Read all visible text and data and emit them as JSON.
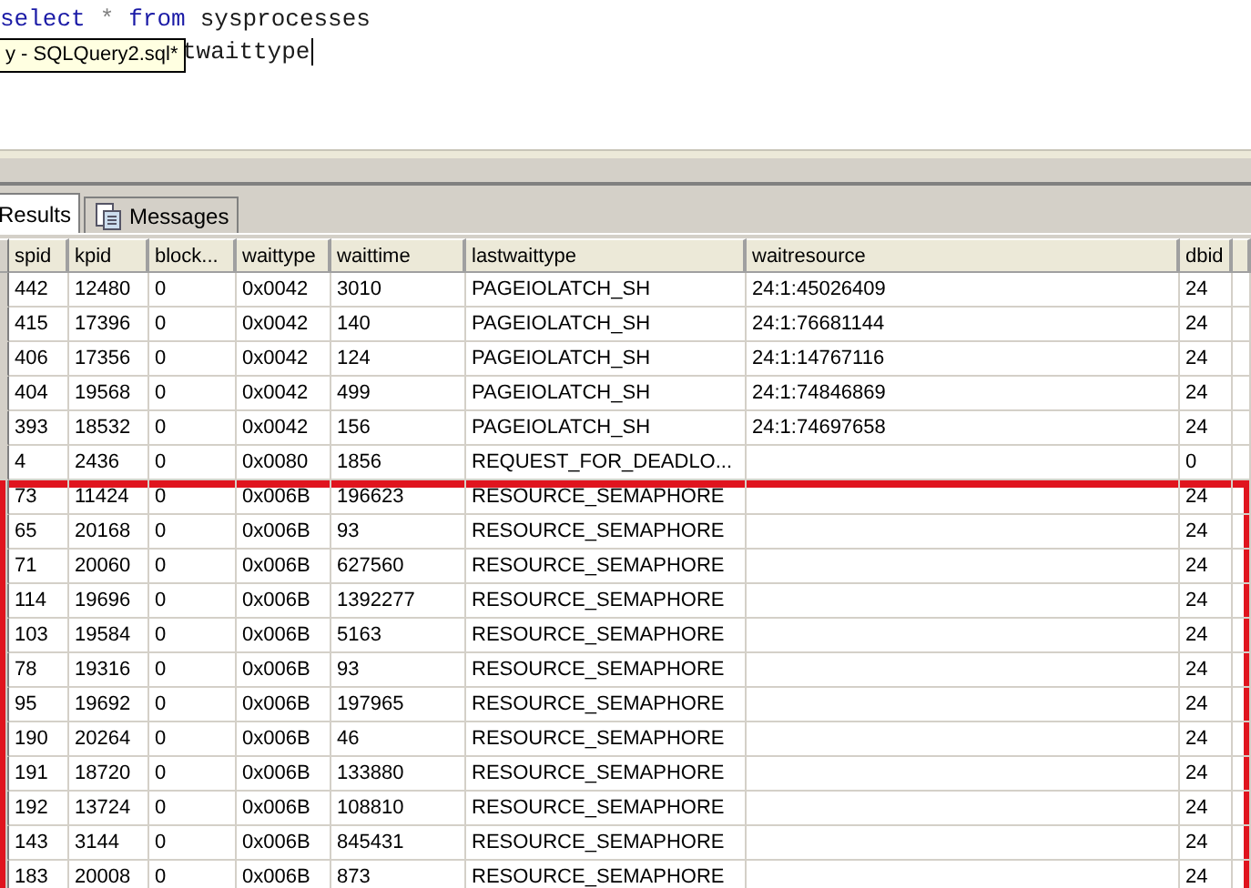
{
  "editor": {
    "lines": [
      {
        "tokens": [
          {
            "text": "select",
            "kind": "keyword"
          },
          {
            "text": "*",
            "kind": "operator"
          },
          {
            "text": "from",
            "kind": "keyword"
          },
          {
            "text": "sysprocesses",
            "kind": "identifier"
          }
        ]
      },
      {
        "tokens": [
          {
            "text": "twaittype",
            "kind": "identifier"
          }
        ],
        "caret": true
      }
    ],
    "tooltip": "y - SQLQuery2.sql*"
  },
  "tabs": [
    {
      "label": "Results",
      "selected": true
    },
    {
      "label": "Messages",
      "selected": false
    }
  ],
  "table": {
    "columns": [
      "spid",
      "kpid",
      "block...",
      "waittype",
      "waittime",
      "lastwaittype",
      "waitresource",
      "dbid"
    ],
    "rows": [
      {
        "cells": [
          "442",
          "12480",
          "0",
          "0x0042",
          "3010",
          "PAGEIOLATCH_SH",
          "24:1:45026409",
          "24"
        ],
        "highlighted": false
      },
      {
        "cells": [
          "415",
          "17396",
          "0",
          "0x0042",
          "140",
          "PAGEIOLATCH_SH",
          "24:1:76681144",
          "24"
        ],
        "highlighted": false
      },
      {
        "cells": [
          "406",
          "17356",
          "0",
          "0x0042",
          "124",
          "PAGEIOLATCH_SH",
          "24:1:14767116",
          "24"
        ],
        "highlighted": false
      },
      {
        "cells": [
          "404",
          "19568",
          "0",
          "0x0042",
          "499",
          "PAGEIOLATCH_SH",
          "24:1:74846869",
          "24"
        ],
        "highlighted": false
      },
      {
        "cells": [
          "393",
          "18532",
          "0",
          "0x0042",
          "156",
          "PAGEIOLATCH_SH",
          "24:1:74697658",
          "24"
        ],
        "highlighted": false
      },
      {
        "cells": [
          "4",
          "2436",
          "0",
          "0x0080",
          "1856",
          "REQUEST_FOR_DEADLO...",
          "",
          "0"
        ],
        "highlighted": false
      },
      {
        "cells": [
          "73",
          "11424",
          "0",
          "0x006B",
          "196623",
          "RESOURCE_SEMAPHORE",
          "",
          "24"
        ],
        "highlighted": true
      },
      {
        "cells": [
          "65",
          "20168",
          "0",
          "0x006B",
          "93",
          "RESOURCE_SEMAPHORE",
          "",
          "24"
        ],
        "highlighted": true
      },
      {
        "cells": [
          "71",
          "20060",
          "0",
          "0x006B",
          "627560",
          "RESOURCE_SEMAPHORE",
          "",
          "24"
        ],
        "highlighted": true
      },
      {
        "cells": [
          "114",
          "19696",
          "0",
          "0x006B",
          "1392277",
          "RESOURCE_SEMAPHORE",
          "",
          "24"
        ],
        "highlighted": true
      },
      {
        "cells": [
          "103",
          "19584",
          "0",
          "0x006B",
          "5163",
          "RESOURCE_SEMAPHORE",
          "",
          "24"
        ],
        "highlighted": true
      },
      {
        "cells": [
          "78",
          "19316",
          "0",
          "0x006B",
          "93",
          "RESOURCE_SEMAPHORE",
          "",
          "24"
        ],
        "highlighted": true
      },
      {
        "cells": [
          "95",
          "19692",
          "0",
          "0x006B",
          "197965",
          "RESOURCE_SEMAPHORE",
          "",
          "24"
        ],
        "highlighted": true
      },
      {
        "cells": [
          "190",
          "20264",
          "0",
          "0x006B",
          "46",
          "RESOURCE_SEMAPHORE",
          "",
          "24"
        ],
        "highlighted": true
      },
      {
        "cells": [
          "191",
          "18720",
          "0",
          "0x006B",
          "133880",
          "RESOURCE_SEMAPHORE",
          "",
          "24"
        ],
        "highlighted": true
      },
      {
        "cells": [
          "192",
          "13724",
          "0",
          "0x006B",
          "108810",
          "RESOURCE_SEMAPHORE",
          "",
          "24"
        ],
        "highlighted": true
      },
      {
        "cells": [
          "143",
          "3144",
          "0",
          "0x006B",
          "845431",
          "RESOURCE_SEMAPHORE",
          "",
          "24"
        ],
        "highlighted": true
      },
      {
        "cells": [
          "183",
          "20008",
          "0",
          "0x006B",
          "873",
          "RESOURCE_SEMAPHORE",
          "",
          "24"
        ],
        "highlighted": true
      }
    ]
  }
}
